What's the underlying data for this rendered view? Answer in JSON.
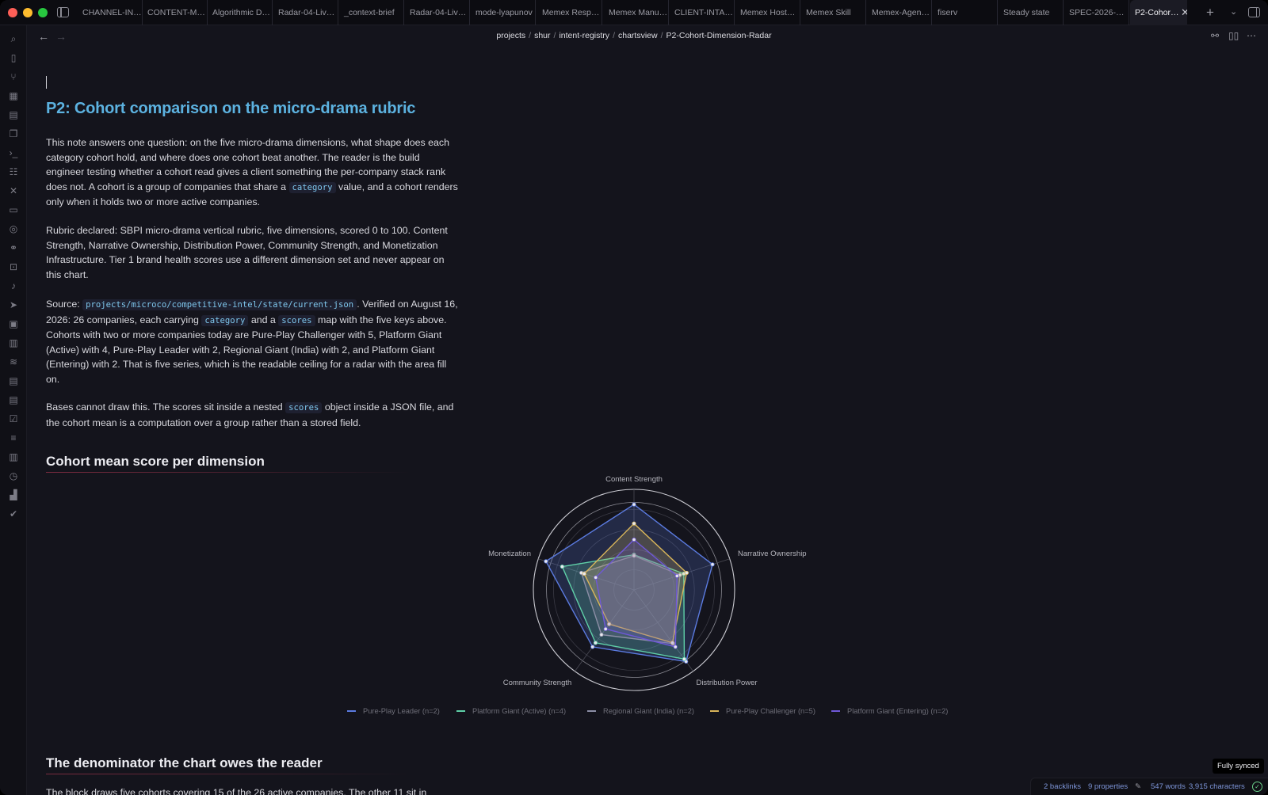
{
  "tabs": [
    {
      "label": "CHANNEL-IN…",
      "active": false
    },
    {
      "label": "CONTENT-M…",
      "active": false
    },
    {
      "label": "Algorithmic D…",
      "active": false
    },
    {
      "label": "Radar-04-Liv…",
      "active": false
    },
    {
      "label": "_context-brief",
      "active": false
    },
    {
      "label": "Radar-04-Liv…",
      "active": false
    },
    {
      "label": "mode-lyapunov",
      "active": false
    },
    {
      "label": "Memex Resp…",
      "active": false
    },
    {
      "label": "Memex Manu…",
      "active": false
    },
    {
      "label": "CLIENT-INTA…",
      "active": false
    },
    {
      "label": "Memex Host…",
      "active": false
    },
    {
      "label": "Memex Skill",
      "active": false
    },
    {
      "label": "Memex-Agen…",
      "active": false
    },
    {
      "label": "fiserv",
      "active": false
    },
    {
      "label": "Steady state",
      "active": false
    },
    {
      "label": "SPEC-2026-…",
      "active": false
    },
    {
      "label": "P2-Cohor…",
      "active": true
    }
  ],
  "breadcrumb": [
    "projects",
    "shur",
    "intent-registry",
    "chartsview",
    "P2-Cohort-Dimension-Radar"
  ],
  "note": {
    "title": "P2: Cohort comparison on the micro-drama rubric",
    "p1": {
      "a": "This note answers one question: on the five micro-drama dimensions, what shape does each category cohort hold, and where does one cohort beat another. The reader is the build engineer testing whether a cohort read gives a client something the per-company stack rank does not. A cohort is a group of companies that share a",
      "code": "category",
      "b": "value, and a cohort renders only when it holds two or more active companies."
    },
    "p2": "Rubric declared: SBPI micro-drama vertical rubric, five dimensions, scored 0 to 100. Content Strength, Narrative Ownership, Distribution Power, Community Strength, and Monetization Infrastructure. Tier 1 brand health scores use a different dimension set and never appear on this chart.",
    "p3": {
      "a": "Source:",
      "code1": "projects/microco/competitive-intel/state/current.json",
      "b": ". Verified on August 16, 2026: 26 companies, each carrying",
      "code2": "category",
      "c": "and a",
      "code3": "scores",
      "d": "map with the five keys above. Cohorts with two or more companies today are Pure-Play Challenger with 5, Platform Giant (Active) with 4, Pure-Play Leader with 2, Regional Giant (India) with 2, and Platform Giant (Entering) with 2. That is five series, which is the readable ceiling for a radar with the area fill on."
    },
    "p4": {
      "a": "Bases cannot draw this. The scores sit inside a nested",
      "code": "scores",
      "b": "object inside a JSON file, and the cohort mean is a computation over a group rather than a stored field."
    },
    "h2a": "Cohort mean score per dimension",
    "h2b": "The denominator the chart owes the reader",
    "p5": "The block draws five cohorts covering 15 of the 26 active companies. The other 11 sit in"
  },
  "chart_data": {
    "type": "radar",
    "axes": [
      "Content Strength",
      "Narrative Ownership",
      "Distribution Power",
      "Community Strength",
      "Monetization"
    ],
    "range": [
      0,
      100
    ],
    "fill": true,
    "legend_position": "bottom",
    "series": [
      {
        "name": "Pure-Play Leader (n=2)",
        "color": "#5b7be0",
        "values": [
          85,
          82,
          88,
          70,
          92
        ]
      },
      {
        "name": "Platform Giant (Active) (n=4)",
        "color": "#5fd0a8",
        "values": [
          35,
          52,
          85,
          65,
          75
        ]
      },
      {
        "name": "Regional Giant (India) (n=2)",
        "color": "#8c8ea6",
        "values": [
          34,
          48,
          66,
          55,
          55
        ]
      },
      {
        "name": "Pure-Play Challenger (n=5)",
        "color": "#d8b55a",
        "values": [
          66,
          55,
          65,
          42,
          52
        ]
      },
      {
        "name": "Platform Giant (Entering) (n=2)",
        "color": "#6f58d8",
        "values": [
          50,
          45,
          70,
          48,
          40
        ]
      }
    ]
  },
  "status": {
    "tooltip": "Fully synced",
    "backlinks": "2 backlinks",
    "properties": "9 properties",
    "words": "547 words",
    "characters": "3,915 characters"
  }
}
